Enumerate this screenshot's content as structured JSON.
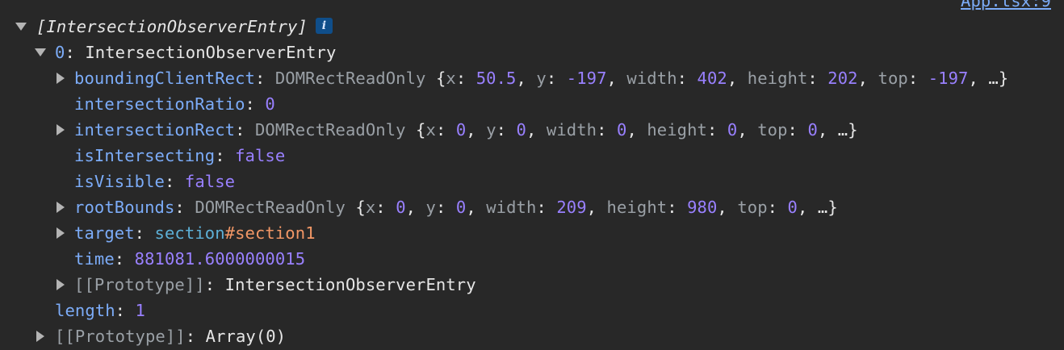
{
  "source_link": "App.tsx:9",
  "root": {
    "label": "[IntersectionObserverEntry]",
    "info_badge": "i"
  },
  "entry": {
    "index": "0",
    "type": "IntersectionObserverEntry"
  },
  "props": {
    "boundingClientRect": {
      "key": "boundingClientRect",
      "type": "DOMRectReadOnly",
      "x": "50.5",
      "y": "-197",
      "width": "402",
      "height": "202",
      "top": "-197",
      "tail": "…"
    },
    "intersectionRatio": {
      "key": "intersectionRatio",
      "value": "0"
    },
    "intersectionRect": {
      "key": "intersectionRect",
      "type": "DOMRectReadOnly",
      "x": "0",
      "y": "0",
      "width": "0",
      "height": "0",
      "top": "0",
      "tail": "…"
    },
    "isIntersecting": {
      "key": "isIntersecting",
      "value": "false"
    },
    "isVisible": {
      "key": "isVisible",
      "value": "false"
    },
    "rootBounds": {
      "key": "rootBounds",
      "type": "DOMRectReadOnly",
      "x": "0",
      "y": "0",
      "width": "209",
      "height": "980",
      "top": "0",
      "tail": "…"
    },
    "target": {
      "key": "target",
      "tag": "section",
      "id": "#section1"
    },
    "time": {
      "key": "time",
      "value": "881081.6000000015"
    },
    "prototype": {
      "key": "[[Prototype]]",
      "value": "IntersectionObserverEntry"
    }
  },
  "length": {
    "key": "length",
    "value": "1"
  },
  "array_prototype": {
    "key": "[[Prototype]]",
    "value": "Array(0)"
  },
  "labels": {
    "x": "x",
    "y": "y",
    "width": "width",
    "height": "height",
    "top": "top"
  }
}
